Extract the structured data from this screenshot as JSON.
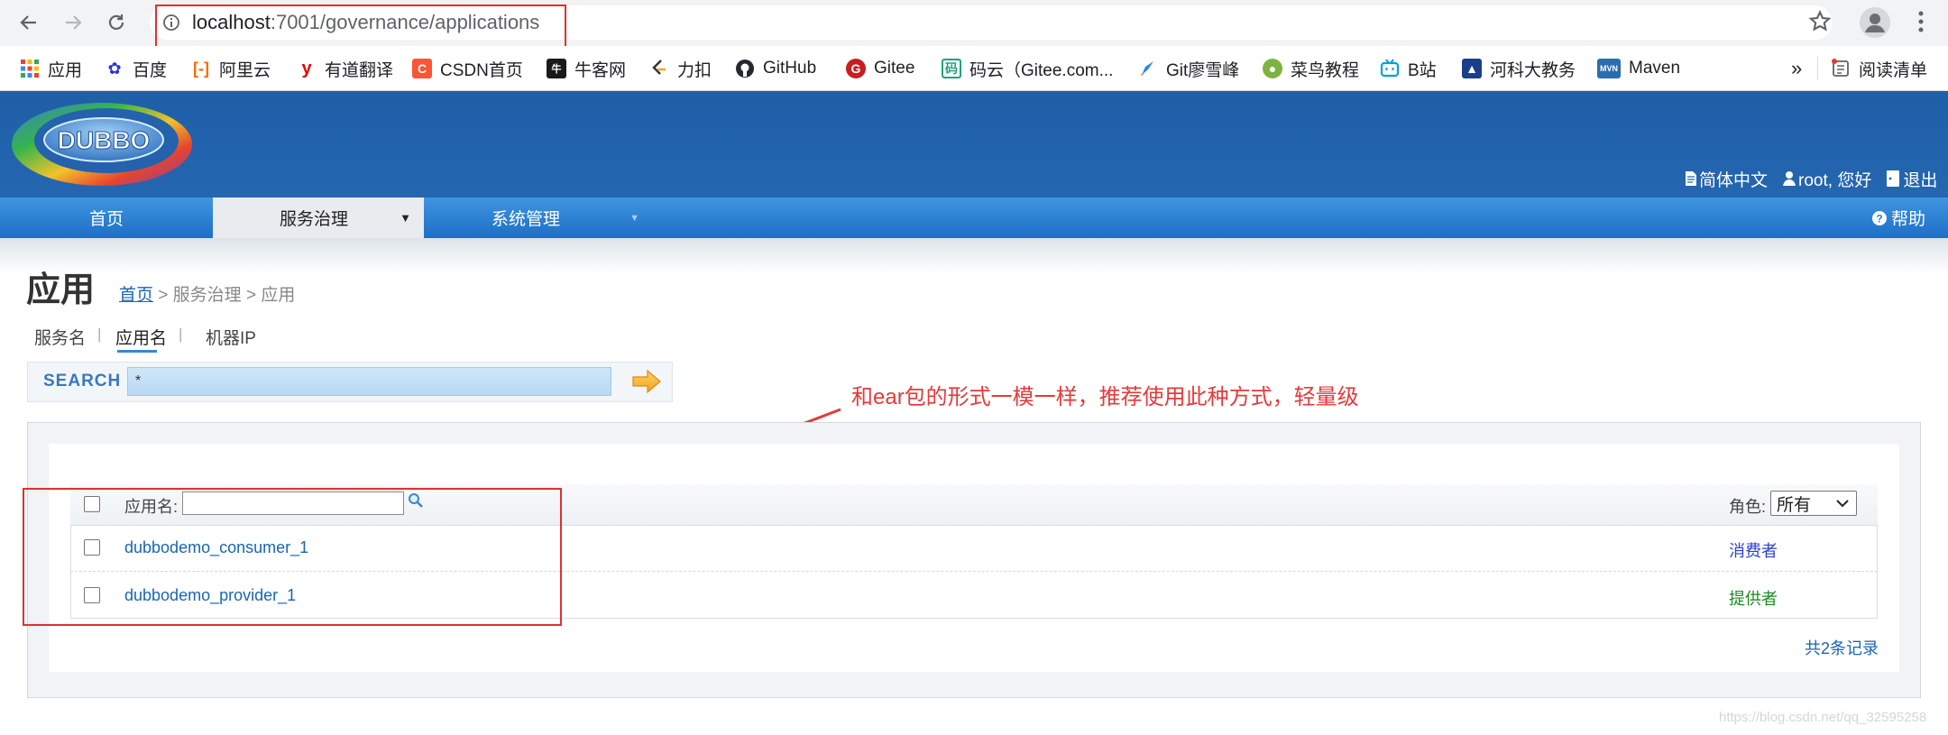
{
  "browser": {
    "url_host": "localhost",
    "url_path": ":7001/governance/applications",
    "bookmarks": [
      {
        "label": "应用",
        "icon": "apps-grid-icon"
      },
      {
        "label": "百度",
        "icon": "baidu-paw-icon",
        "color": "#2932e1"
      },
      {
        "label": "阿里云",
        "icon": "aliyun-icon",
        "color": "#ff6a00"
      },
      {
        "label": "有道翻译",
        "icon": "youdao-icon",
        "color": "#e10602"
      },
      {
        "label": "CSDN首页",
        "icon": "csdn-icon",
        "color": "#fc5531"
      },
      {
        "label": "牛客网",
        "icon": "nowcoder-icon",
        "color": "#1a1a1a"
      },
      {
        "label": "力扣",
        "icon": "leetcode-icon",
        "color": "#333333"
      },
      {
        "label": "GitHub",
        "icon": "github-icon",
        "color": "#24292e"
      },
      {
        "label": "Gitee",
        "icon": "gitee-icon",
        "color": "#c71d23"
      },
      {
        "label": "码云（Gitee.com...",
        "icon": "gitee-code-icon",
        "color": "#20a37b"
      },
      {
        "label": "Git廖雪峰",
        "icon": "rocket-icon",
        "color": "#2a86e8"
      },
      {
        "label": "菜鸟教程",
        "icon": "runoob-icon",
        "color": "#7cb342"
      },
      {
        "label": "B站",
        "icon": "bilibili-icon",
        "color": "#00a1d6"
      },
      {
        "label": "河科大教务",
        "icon": "university-icon",
        "color": "#1a3f8a"
      },
      {
        "label": "Maven",
        "icon": "maven-icon",
        "color": "#2b6cb0"
      }
    ],
    "more_label": "»",
    "reading_list_label": "阅读清单"
  },
  "app": {
    "logo_text": "DUBBO",
    "links": {
      "language": "简体中文",
      "user": "root, 您好",
      "logout": "退出",
      "help": "帮助"
    },
    "nav": [
      {
        "label": "首页"
      },
      {
        "label": "服务治理",
        "arrow": "▼"
      },
      {
        "label": "系统管理",
        "arrow": "▼"
      }
    ],
    "page_title": "应用",
    "breadcrumb": {
      "home": "首页",
      "rest": " > 服务治理 > 应用"
    },
    "subtabs": [
      "服务名",
      "应用名",
      "机器IP"
    ],
    "search": {
      "label": "SEARCH",
      "value": "*"
    },
    "table": {
      "filter_label": "应用名:",
      "role_label": "角色:",
      "role_selected": "所有",
      "rows": [
        {
          "name": "dubbodemo_consumer_1",
          "role": "消费者",
          "role_color": "#2a3fd0"
        },
        {
          "name": "dubbodemo_provider_1",
          "role": "提供者",
          "role_color": "#1e8a1e"
        }
      ]
    },
    "record_count": "共2条记录"
  },
  "annotation": "和ear包的形式一模一样，推荐使用此种方式，轻量级",
  "watermark": "https://blog.csdn.net/qq_32595258",
  "colors": {
    "header_blue": "#1e5fa8",
    "nav_blue": "#2f84d6",
    "annotation_red": "#e33a3a",
    "link_blue": "#1a65b3"
  }
}
